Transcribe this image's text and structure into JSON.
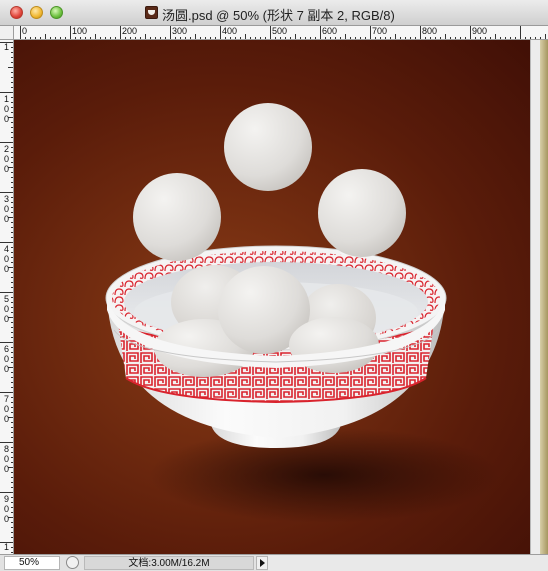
{
  "window": {
    "title": "汤圆.psd @ 50% (形状 7 副本 2, RGB/8)",
    "file_icon": "psd-file-icon"
  },
  "rulers": {
    "horizontal": [
      "0",
      "100",
      "200",
      "300",
      "400",
      "500",
      "600",
      "700",
      "800",
      "900"
    ],
    "vertical": [
      "1",
      "100",
      "200",
      "300",
      "400",
      "500",
      "600",
      "700",
      "800",
      "900",
      "1"
    ]
  },
  "status": {
    "zoom": "50%",
    "doc_info": "文档:3.00M/16.2M"
  },
  "colors": {
    "background": "#5a1c0a",
    "bowl": "#f2f2f2",
    "pattern": "#d9232d",
    "ball": "#e4e2df"
  }
}
